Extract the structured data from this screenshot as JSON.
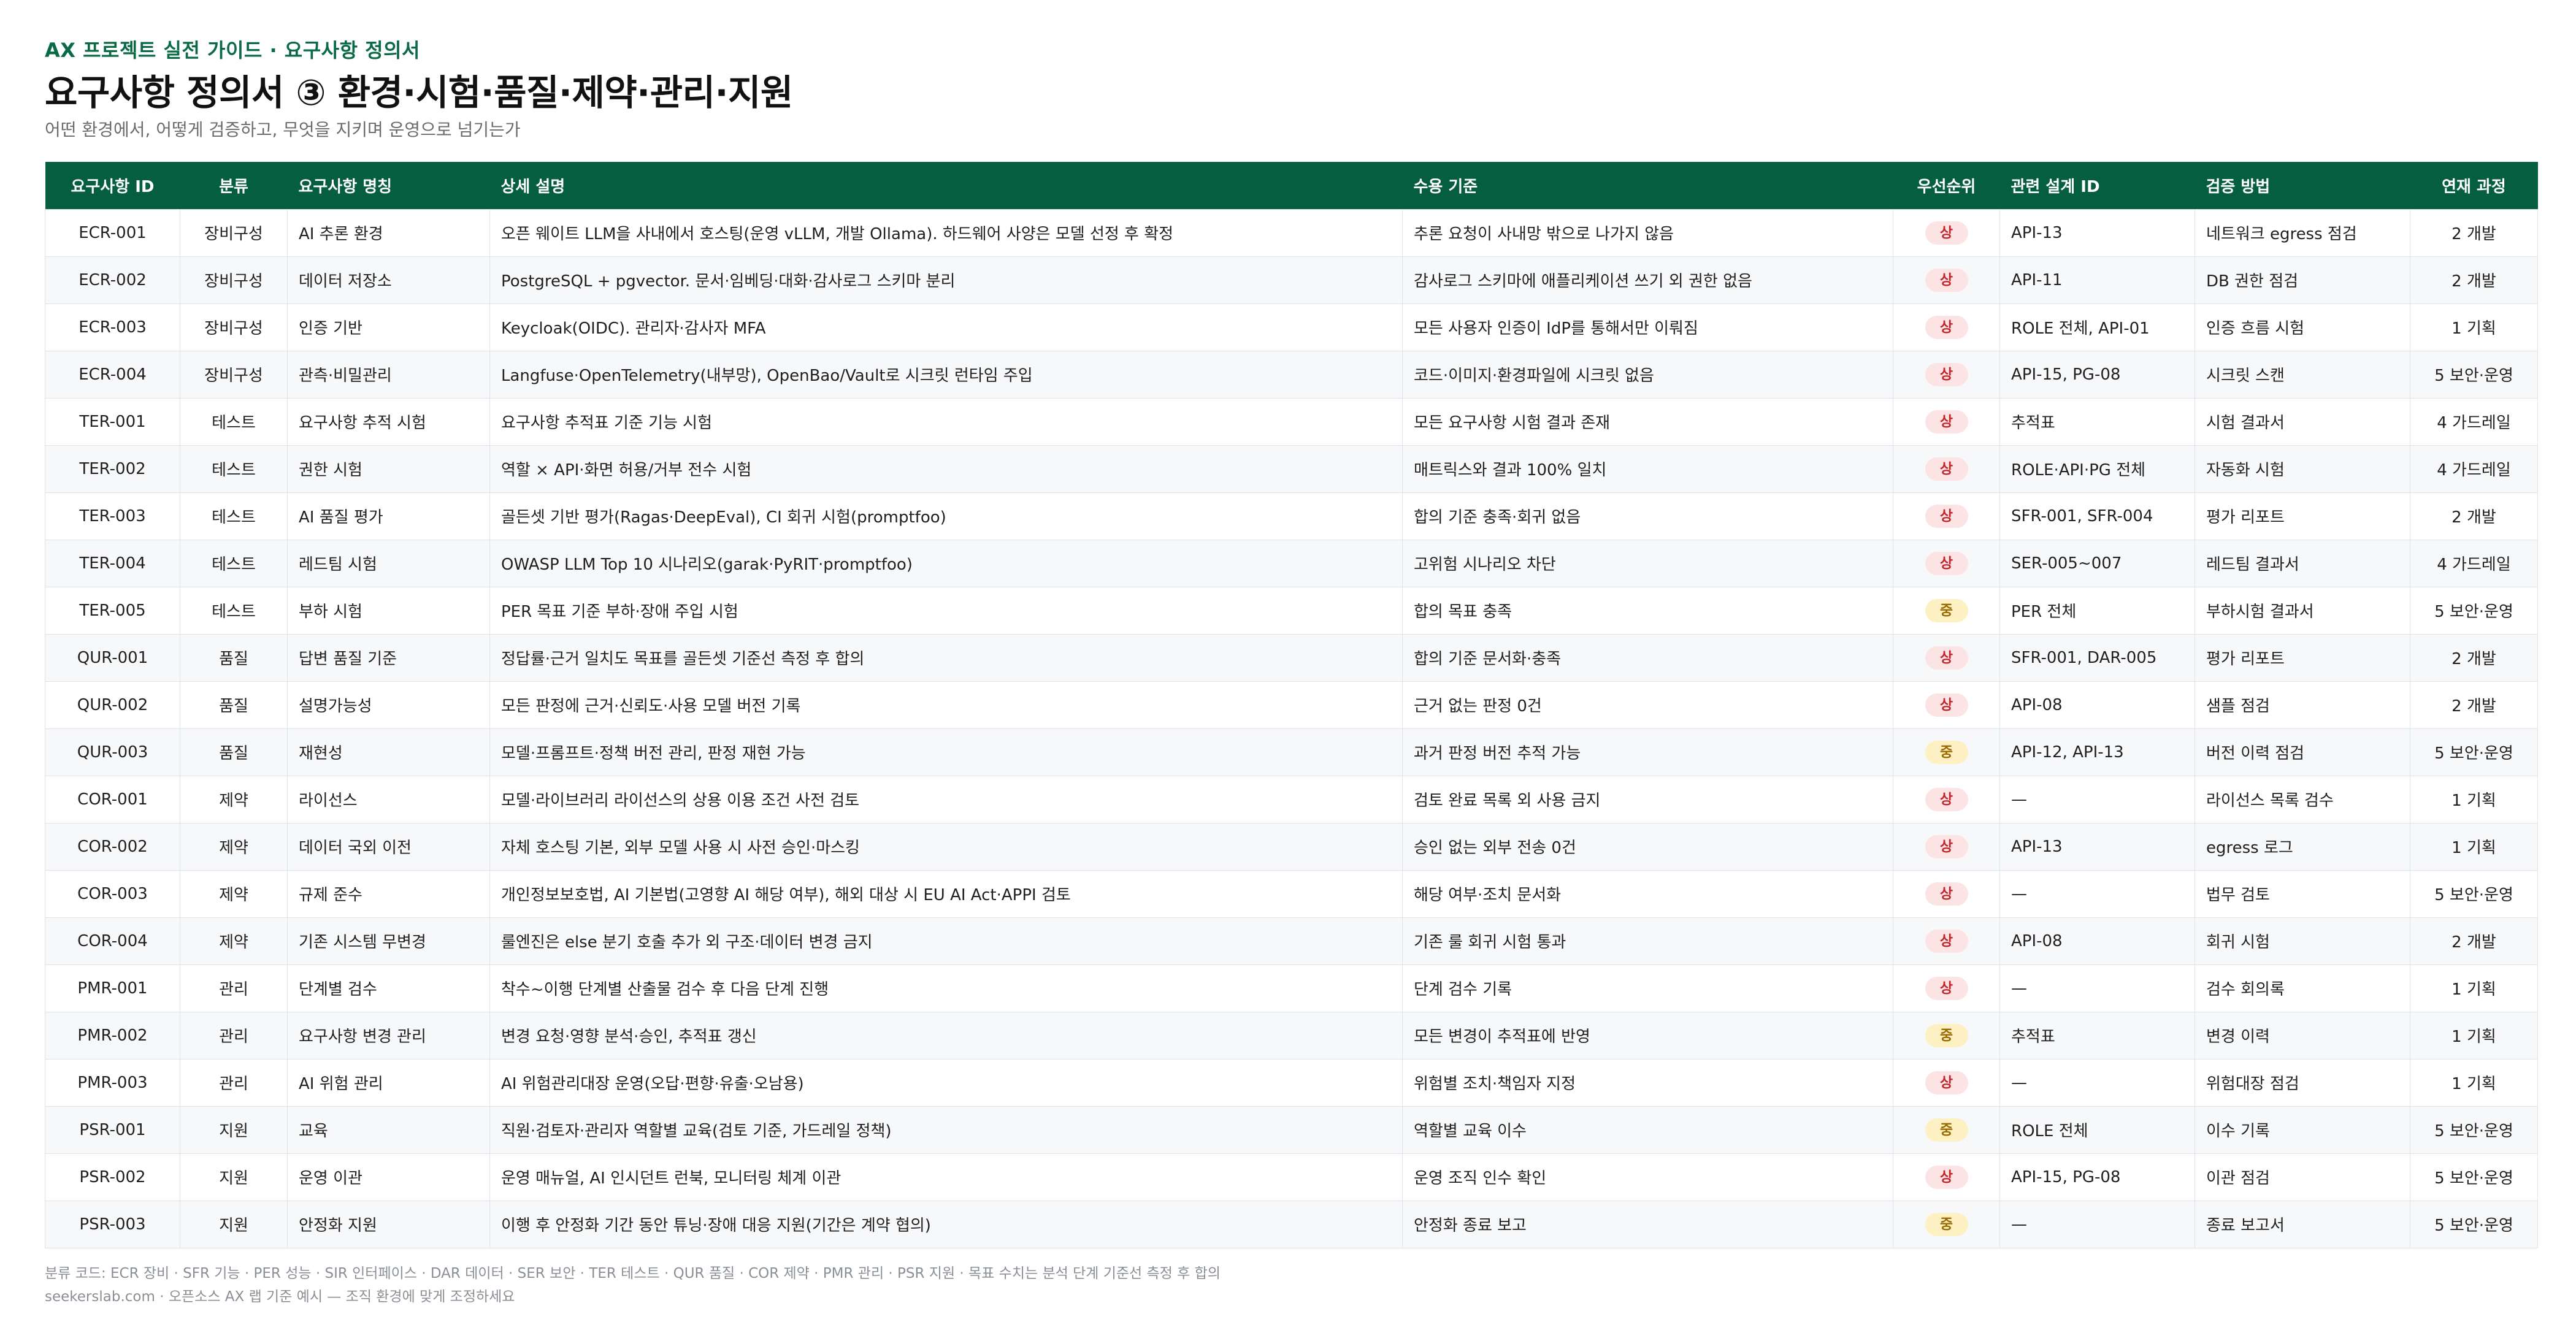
{
  "header": {
    "eyebrow": "AX 프로젝트 실전 가이드 · 요구사항 정의서",
    "title": "요구사항 정의서 ③ 환경·시험·품질·제약·관리·지원",
    "subtitle": "어떤 환경에서, 어떻게 검증하고, 무엇을 지키며 운영으로 넘기는가"
  },
  "table": {
    "columns": [
      "요구사항 ID",
      "분류",
      "요구사항 명칭",
      "상세 설명",
      "수용 기준",
      "우선순위",
      "관련 설계 ID",
      "검증 방법",
      "연재 과정"
    ],
    "priority_colors": {
      "상": "#c0262d",
      "중": "#9a6b00"
    },
    "rows": [
      {
        "id": "ECR-001",
        "cat": "장비구성",
        "name": "AI 추론 환경",
        "desc": "오픈 웨이트 LLM을 사내에서 호스팅(운영 vLLM, 개발 Ollama). 하드웨어 사양은 모델 선정 후 확정",
        "accept": "추론 요청이 사내망 밖으로 나가지 않음",
        "prio": "상",
        "design": "API-13",
        "verify": "네트워크 egress 점검",
        "series": "2 개발"
      },
      {
        "id": "ECR-002",
        "cat": "장비구성",
        "name": "데이터 저장소",
        "desc": "PostgreSQL + pgvector. 문서·임베딩·대화·감사로그 스키마 분리",
        "accept": "감사로그 스키마에 애플리케이션 쓰기 외 권한 없음",
        "prio": "상",
        "design": "API-11",
        "verify": "DB 권한 점검",
        "series": "2 개발"
      },
      {
        "id": "ECR-003",
        "cat": "장비구성",
        "name": "인증 기반",
        "desc": "Keycloak(OIDC). 관리자·감사자 MFA",
        "accept": "모든 사용자 인증이 IdP를 통해서만 이뤄짐",
        "prio": "상",
        "design": "ROLE 전체, API-01",
        "verify": "인증 흐름 시험",
        "series": "1 기획"
      },
      {
        "id": "ECR-004",
        "cat": "장비구성",
        "name": "관측·비밀관리",
        "desc": "Langfuse·OpenTelemetry(내부망), OpenBao/Vault로 시크릿 런타임 주입",
        "accept": "코드·이미지·환경파일에 시크릿 없음",
        "prio": "상",
        "design": "API-15, PG-08",
        "verify": "시크릿 스캔",
        "series": "5 보안·운영"
      },
      {
        "id": "TER-001",
        "cat": "테스트",
        "name": "요구사항 추적 시험",
        "desc": "요구사항 추적표 기준 기능 시험",
        "accept": "모든 요구사항 시험 결과 존재",
        "prio": "상",
        "design": "추적표",
        "verify": "시험 결과서",
        "series": "4 가드레일"
      },
      {
        "id": "TER-002",
        "cat": "테스트",
        "name": "권한 시험",
        "desc": "역할 × API·화면 허용/거부 전수 시험",
        "accept": "매트릭스와 결과 100% 일치",
        "prio": "상",
        "design": "ROLE·API·PG 전체",
        "verify": "자동화 시험",
        "series": "4 가드레일"
      },
      {
        "id": "TER-003",
        "cat": "테스트",
        "name": "AI 품질 평가",
        "desc": "골든셋 기반 평가(Ragas·DeepEval), CI 회귀 시험(promptfoo)",
        "accept": "합의 기준 충족·회귀 없음",
        "prio": "상",
        "design": "SFR-001, SFR-004",
        "verify": "평가 리포트",
        "series": "2 개발"
      },
      {
        "id": "TER-004",
        "cat": "테스트",
        "name": "레드팀 시험",
        "desc": "OWASP LLM Top 10 시나리오(garak·PyRIT·promptfoo)",
        "accept": "고위험 시나리오 차단",
        "prio": "상",
        "design": "SER-005~007",
        "verify": "레드팀 결과서",
        "series": "4 가드레일"
      },
      {
        "id": "TER-005",
        "cat": "테스트",
        "name": "부하 시험",
        "desc": "PER 목표 기준 부하·장애 주입 시험",
        "accept": "합의 목표 충족",
        "prio": "중",
        "design": "PER 전체",
        "verify": "부하시험 결과서",
        "series": "5 보안·운영"
      },
      {
        "id": "QUR-001",
        "cat": "품질",
        "name": "답변 품질 기준",
        "desc": "정답률·근거 일치도 목표를 골든셋 기준선 측정 후 합의",
        "accept": "합의 기준 문서화·충족",
        "prio": "상",
        "design": "SFR-001, DAR-005",
        "verify": "평가 리포트",
        "series": "2 개발"
      },
      {
        "id": "QUR-002",
        "cat": "품질",
        "name": "설명가능성",
        "desc": "모든 판정에 근거·신뢰도·사용 모델 버전 기록",
        "accept": "근거 없는 판정 0건",
        "prio": "상",
        "design": "API-08",
        "verify": "샘플 점검",
        "series": "2 개발"
      },
      {
        "id": "QUR-003",
        "cat": "품질",
        "name": "재현성",
        "desc": "모델·프롬프트·정책 버전 관리, 판정 재현 가능",
        "accept": "과거 판정 버전 추적 가능",
        "prio": "중",
        "design": "API-12, API-13",
        "verify": "버전 이력 점검",
        "series": "5 보안·운영"
      },
      {
        "id": "COR-001",
        "cat": "제약",
        "name": "라이선스",
        "desc": "모델·라이브러리 라이선스의 상용 이용 조건 사전 검토",
        "accept": "검토 완료 목록 외 사용 금지",
        "prio": "상",
        "design": "—",
        "verify": "라이선스 목록 검수",
        "series": "1 기획"
      },
      {
        "id": "COR-002",
        "cat": "제약",
        "name": "데이터 국외 이전",
        "desc": "자체 호스팅 기본, 외부 모델 사용 시 사전 승인·마스킹",
        "accept": "승인 없는 외부 전송 0건",
        "prio": "상",
        "design": "API-13",
        "verify": "egress 로그",
        "series": "1 기획"
      },
      {
        "id": "COR-003",
        "cat": "제약",
        "name": "규제 준수",
        "desc": "개인정보보호법, AI 기본법(고영향 AI 해당 여부), 해외 대상 시 EU AI Act·APPI 검토",
        "accept": "해당 여부·조치 문서화",
        "prio": "상",
        "design": "—",
        "verify": "법무 검토",
        "series": "5 보안·운영"
      },
      {
        "id": "COR-004",
        "cat": "제약",
        "name": "기존 시스템 무변경",
        "desc": "룰엔진은 else 분기 호출 추가 외 구조·데이터 변경 금지",
        "accept": "기존 룰 회귀 시험 통과",
        "prio": "상",
        "design": "API-08",
        "verify": "회귀 시험",
        "series": "2 개발"
      },
      {
        "id": "PMR-001",
        "cat": "관리",
        "name": "단계별 검수",
        "desc": "착수~이행 단계별 산출물 검수 후 다음 단계 진행",
        "accept": "단계 검수 기록",
        "prio": "상",
        "design": "—",
        "verify": "검수 회의록",
        "series": "1 기획"
      },
      {
        "id": "PMR-002",
        "cat": "관리",
        "name": "요구사항 변경 관리",
        "desc": "변경 요청·영향 분석·승인, 추적표 갱신",
        "accept": "모든 변경이 추적표에 반영",
        "prio": "중",
        "design": "추적표",
        "verify": "변경 이력",
        "series": "1 기획"
      },
      {
        "id": "PMR-003",
        "cat": "관리",
        "name": "AI 위험 관리",
        "desc": "AI 위험관리대장 운영(오답·편향·유출·오남용)",
        "accept": "위험별 조치·책임자 지정",
        "prio": "상",
        "design": "—",
        "verify": "위험대장 점검",
        "series": "1 기획"
      },
      {
        "id": "PSR-001",
        "cat": "지원",
        "name": "교육",
        "desc": "직원·검토자·관리자 역할별 교육(검토 기준, 가드레일 정책)",
        "accept": "역할별 교육 이수",
        "prio": "중",
        "design": "ROLE 전체",
        "verify": "이수 기록",
        "series": "5 보안·운영"
      },
      {
        "id": "PSR-002",
        "cat": "지원",
        "name": "운영 이관",
        "desc": "운영 매뉴얼, AI 인시던트 런북, 모니터링 체계 이관",
        "accept": "운영 조직 인수 확인",
        "prio": "상",
        "design": "API-15, PG-08",
        "verify": "이관 점검",
        "series": "5 보안·운영"
      },
      {
        "id": "PSR-003",
        "cat": "지원",
        "name": "안정화 지원",
        "desc": "이행 후 안정화 기간 동안 튜닝·장애 대응 지원(기간은 계약 협의)",
        "accept": "안정화 종료 보고",
        "prio": "중",
        "design": "—",
        "verify": "종료 보고서",
        "series": "5 보안·운영"
      }
    ]
  },
  "footer": {
    "note": "분류 코드: ECR 장비 · SFR 기능 · PER 성능 · SIR 인터페이스 · DAR 데이터 · SER 보안 · TER 테스트 · QUR 품질 · COR 제약 · PMR 관리 · PSR 지원 · 목표 수치는 분석 단계 기준선 측정 후 합의",
    "credit": "seekerslab.com · 오픈소스 AX 랩 기준 예시 — 조직 환경에 맞게 조정하세요"
  }
}
